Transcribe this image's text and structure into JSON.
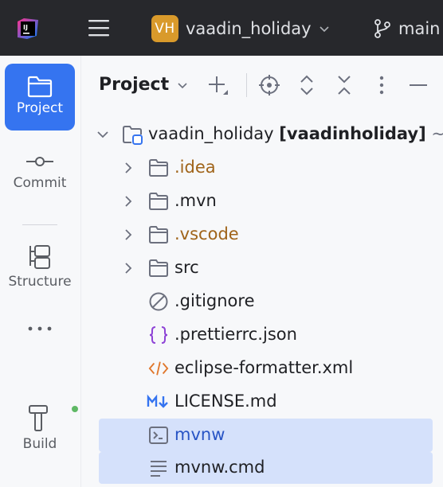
{
  "titlebar": {
    "project_badge": "VH",
    "project_name": "vaadin_holiday",
    "branch_name": "main"
  },
  "toolstrip": {
    "project_label": "Project",
    "commit_label": "Commit",
    "structure_label": "Structure",
    "build_label": "Build"
  },
  "panel": {
    "title": "Project"
  },
  "tree": {
    "root": {
      "name": "vaadin_holiday",
      "module": "[vaadinholiday]",
      "suffix": "~"
    },
    "items": [
      {
        "name": ".idea",
        "type": "folder"
      },
      {
        "name": ".mvn",
        "type": "folder"
      },
      {
        "name": ".vscode",
        "type": "folder"
      },
      {
        "name": "src",
        "type": "folder"
      },
      {
        "name": ".gitignore",
        "type": "ignore-file"
      },
      {
        "name": ".prettierrc.json",
        "type": "json-file"
      },
      {
        "name": "eclipse-formatter.xml",
        "type": "xml-file"
      },
      {
        "name": "LICENSE.md",
        "type": "markdown-file"
      },
      {
        "name": "mvnw",
        "type": "shell-file"
      },
      {
        "name": "mvnw.cmd",
        "type": "text-file"
      }
    ]
  },
  "colors": {
    "accent": "#3574f0",
    "selection": "#d5e1fb",
    "excluded_folder_text": "#a0641a",
    "project_badge": "#d99a2b"
  }
}
